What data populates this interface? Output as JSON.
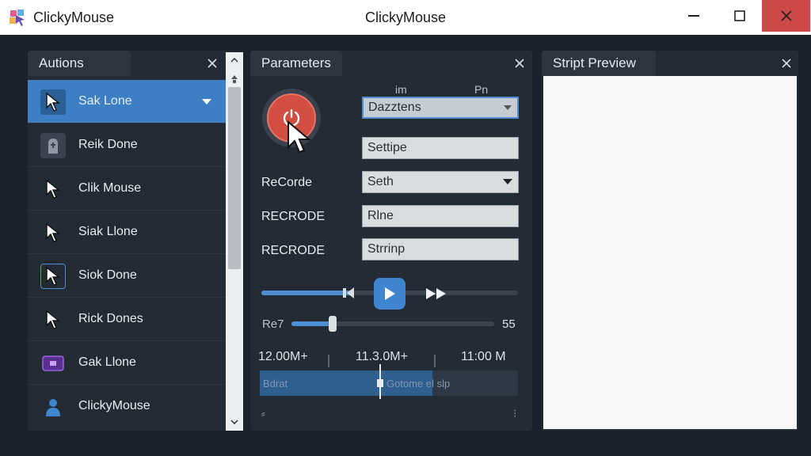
{
  "window": {
    "app_name": "ClickyMouse",
    "title": "ClickyMouse",
    "close_color": "#cc4a48"
  },
  "actions_panel": {
    "title": "Autions",
    "items": [
      {
        "label": "Sak Lone",
        "icon": "cursor-icon",
        "selected": true
      },
      {
        "label": "Reik Done",
        "icon": "tombstone-icon"
      },
      {
        "label": "Clik Mouse",
        "icon": "cursor-icon"
      },
      {
        "label": "Siak Llone",
        "icon": "cursor-icon"
      },
      {
        "label": "Siok Done",
        "icon": "cursor-box-icon"
      },
      {
        "label": "Rick Dones",
        "icon": "cursor-icon"
      },
      {
        "label": "Gak Llone",
        "icon": "purple-box-icon"
      },
      {
        "label": "ClickyMouse",
        "icon": "person-icon"
      }
    ]
  },
  "parameters_panel": {
    "title": "Parameters",
    "col_head_left": "im",
    "col_head_right": "Pn",
    "fields": [
      {
        "label": "",
        "value": "Dazztens",
        "type": "select",
        "focused": true
      },
      {
        "label": "",
        "value": "Settipe",
        "type": "text"
      },
      {
        "label": "ReCorde",
        "value": "Seth",
        "type": "select"
      },
      {
        "label": "RECRODE",
        "value": "Rlne",
        "type": "text"
      },
      {
        "label": "RECRODE",
        "value": "Strrinp",
        "type": "text"
      }
    ],
    "transport_progress": 0.36,
    "speed_label": "Re7",
    "speed_value": "55",
    "speed_fraction": 0.22,
    "timeline": {
      "times": [
        "12.00M+",
        "11.3.0M+",
        "11:00 M"
      ],
      "fill_fraction": 0.67,
      "left_text": "Bdrat",
      "right_text": "Gotome el slp",
      "foot_left": "⸗",
      "foot_right": "⁝"
    }
  },
  "preview_panel": {
    "title": "Stript Preview"
  },
  "colors": {
    "accent": "#3c7fc4",
    "record": "#d24e43",
    "panel_bg": "#232b35",
    "window_bg": "#1b222b"
  }
}
